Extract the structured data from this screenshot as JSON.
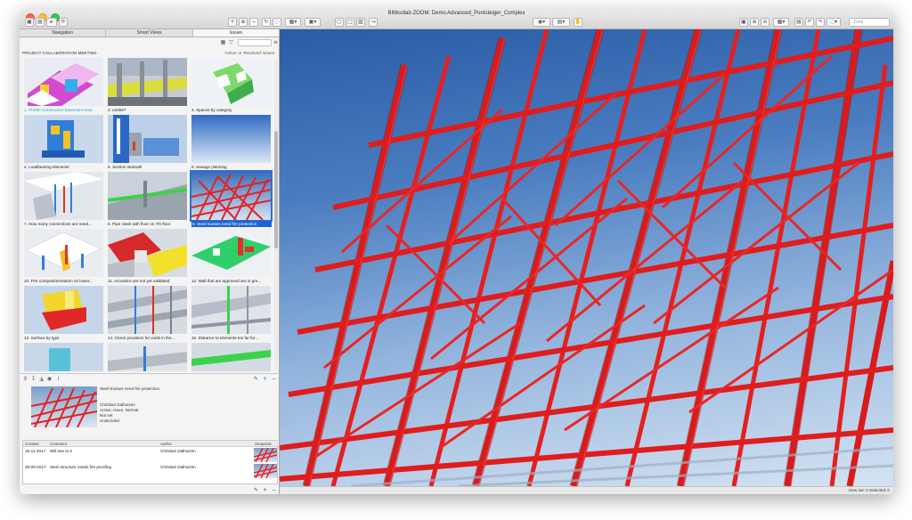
{
  "window": {
    "title": "BIMcollab ZOOM: Demo Advanced_Pontsteiger_Complex"
  },
  "toolbar": {
    "search_placeholder": "Zoek"
  },
  "sidebar": {
    "tabs": [
      {
        "label": "Navigation"
      },
      {
        "label": "Smart Views"
      },
      {
        "label": "Issues",
        "active": true
      }
    ],
    "section_title": "PROJECT COLLABORATION MEETING",
    "filter_note": "'Active' or 'Resolved' issues",
    "issues": [
      {
        "label": "1. Prefab construction basement area",
        "style": "link"
      },
      {
        "label": "2. e34567"
      },
      {
        "label": "3. Spaces by category"
      },
      {
        "label": "4. Loadbearing elements"
      },
      {
        "label": "5. Section stairwell"
      },
      {
        "label": "6. sewage planning"
      },
      {
        "label": "7. How many connections are need..."
      },
      {
        "label": "8. Pipe clash with floor on 7th floor"
      },
      {
        "label": "9. Steel trusses need fire protection",
        "selected": true
      },
      {
        "label": "10. Fire compartimentation on lower..."
      },
      {
        "label": "11. Acoustics are not yet validated"
      },
      {
        "label": "12. Wall that are approved are in gre..."
      },
      {
        "label": "13. Surface by type"
      },
      {
        "label": "14. Check provision for voids in the..."
      },
      {
        "label": "15. Distance to elements too far for..."
      }
    ],
    "selected_issue": {
      "title": "Steel trusses need fire protection",
      "author": "Christian Dalhuizen",
      "status": "Active, Issue, Normal",
      "due": "Not set",
      "assigned": "Undecided"
    },
    "comments": {
      "headers": {
        "created": "Created",
        "comment": "Comment",
        "author": "Author",
        "snapshot": "Snapshot"
      },
      "rows": [
        {
          "created": "16-11-2017",
          "comment": "Will see to it",
          "author": "Christian Dalhuizen"
        },
        {
          "created": "28-09-2017",
          "comment": "Steel structure needs fire proofing",
          "author": "Christian Dalhuizen"
        }
      ]
    }
  },
  "statusbar": {
    "text": "View set: 0   Selected: 0"
  },
  "colors": {
    "steel": "#e02020",
    "selection": "#1f63d1",
    "link_text": "#1da7c8",
    "sky_top": "#2a5ca6",
    "sky_bottom": "#d4e3f2"
  }
}
